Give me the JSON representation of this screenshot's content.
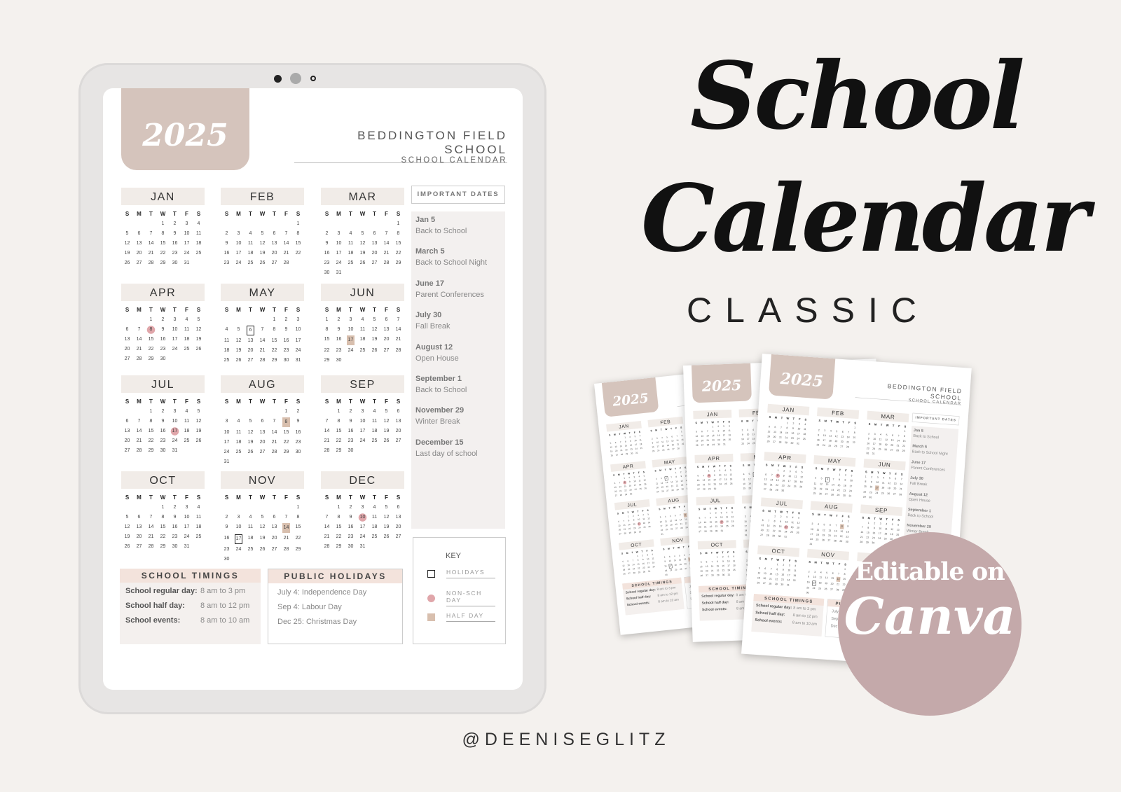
{
  "calendar": {
    "year": "2025",
    "school_name": "BEDDINGTON FIELD SCHOOL",
    "subtitle": "SCHOOL CALENDAR",
    "weekdays": [
      "S",
      "M",
      "T",
      "W",
      "T",
      "F",
      "S"
    ],
    "months": [
      {
        "name": "JAN",
        "first_weekday": "Wed",
        "days": 31,
        "marks": {}
      },
      {
        "name": "FEB",
        "first_weekday": "Sat",
        "days": 28,
        "marks": {}
      },
      {
        "name": "MAR",
        "first_weekday": "Sat",
        "days": 31,
        "marks": {}
      },
      {
        "name": "APR",
        "first_weekday": "Tue",
        "days": 30,
        "marks": {
          "8": "non"
        }
      },
      {
        "name": "MAY",
        "first_weekday": "Thu",
        "days": 31,
        "marks": {
          "6": "hol"
        }
      },
      {
        "name": "JUN",
        "first_weekday": "Sun",
        "days": 30,
        "marks": {
          "17": "half"
        }
      },
      {
        "name": "JUL",
        "first_weekday": "Tue",
        "days": 31,
        "marks": {
          "17": "non"
        }
      },
      {
        "name": "AUG",
        "first_weekday": "Fri",
        "days": 31,
        "marks": {
          "8": "half"
        }
      },
      {
        "name": "SEP",
        "first_weekday": "Mon",
        "days": 30,
        "marks": {}
      },
      {
        "name": "OCT",
        "first_weekday": "Wed",
        "days": 31,
        "marks": {}
      },
      {
        "name": "NOV",
        "first_weekday": "Sat",
        "days": 30,
        "marks": {
          "14": "half",
          "17": "hol"
        }
      },
      {
        "name": "DEC",
        "first_weekday": "Mon",
        "days": 31,
        "marks": {
          "10": "non"
        }
      }
    ],
    "important_dates": {
      "title": "IMPORTANT DATES",
      "items": [
        {
          "date": "Jan 5",
          "event": "Back to School"
        },
        {
          "date": "March 5",
          "event": "Back to School Night"
        },
        {
          "date": "June 17",
          "event": "Parent Conferences"
        },
        {
          "date": "July 30",
          "event": "Fall Break"
        },
        {
          "date": "August 12",
          "event": "Open House"
        },
        {
          "date": "September 1",
          "event": "Back to School"
        },
        {
          "date": "November 29",
          "event": "Winter Break"
        },
        {
          "date": "December 15",
          "event": "Last day of school"
        }
      ]
    },
    "school_timings": {
      "title": "SCHOOL TIMINGS",
      "rows": [
        {
          "label": "School regular day:",
          "value": "8 am to 3 pm"
        },
        {
          "label": "School half day:",
          "value": "8 am to 12 pm"
        },
        {
          "label": "School events:",
          "value": "8 am to 10 am"
        }
      ]
    },
    "public_holidays": {
      "title": "PUBLIC HOLIDAYS",
      "items": [
        "July 4: Independence Day",
        "Sep 4: Labour Day",
        "Dec 25: Christmas Day"
      ]
    },
    "key": {
      "title": "KEY",
      "items": [
        {
          "label": "HOLIDAYS",
          "symbol": "square-outline",
          "color": "#222222"
        },
        {
          "label": "NON-SCH DAY",
          "symbol": "circle",
          "color": "#e0a6aa"
        },
        {
          "label": "HALF DAY",
          "symbol": "square-fill",
          "color": "#d8bfae"
        }
      ]
    }
  },
  "promo": {
    "title_line1": "School",
    "title_line2": "Calendar",
    "style": "CLASSIC",
    "badge_line1": "Editable on",
    "badge_line2": "Canva",
    "handle": "@DEENISEGLITZ"
  },
  "colors": {
    "background": "#f4f1ee",
    "tab": "#d5c4bc",
    "month_header": "#f1ece8",
    "badge": "#c4a9aa",
    "non_school": "#e0a6aa",
    "half_day": "#d8bfae"
  }
}
